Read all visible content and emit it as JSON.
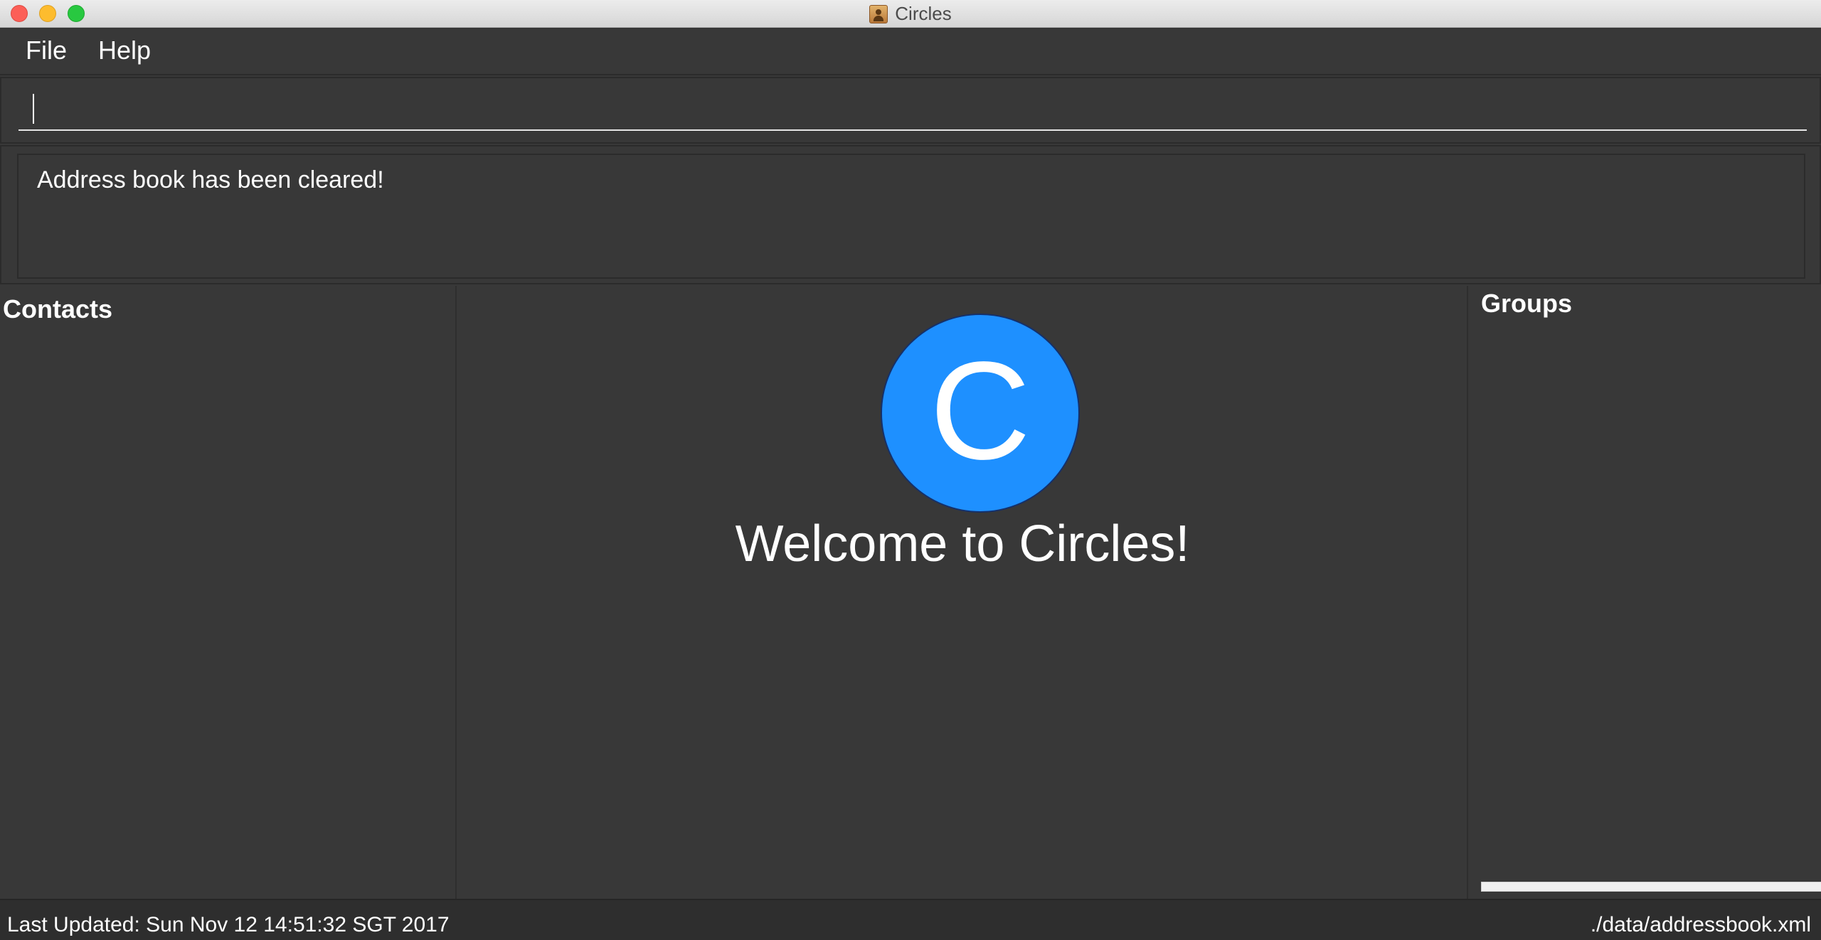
{
  "window": {
    "title": "Circles",
    "app_icon": "address-book-icon"
  },
  "menu": {
    "items": [
      {
        "label": "File"
      },
      {
        "label": "Help"
      }
    ]
  },
  "command_box": {
    "value": "",
    "placeholder": ""
  },
  "result_display": {
    "text": "Address book has been cleared!"
  },
  "contacts_panel": {
    "title": "Contacts",
    "items": []
  },
  "welcome": {
    "logo_letter": "C",
    "logo_color": "#1E90FF",
    "message": "Welcome to Circles!"
  },
  "groups_panel": {
    "title": "Groups",
    "items": []
  },
  "status_bar": {
    "last_updated": "Last Updated: Sun Nov 12 14:51:32 SGT 2017",
    "file_path": "./data/addressbook.xml"
  },
  "colors": {
    "background": "#383838",
    "accent": "#1E90FF",
    "text": "#FFFFFF"
  }
}
